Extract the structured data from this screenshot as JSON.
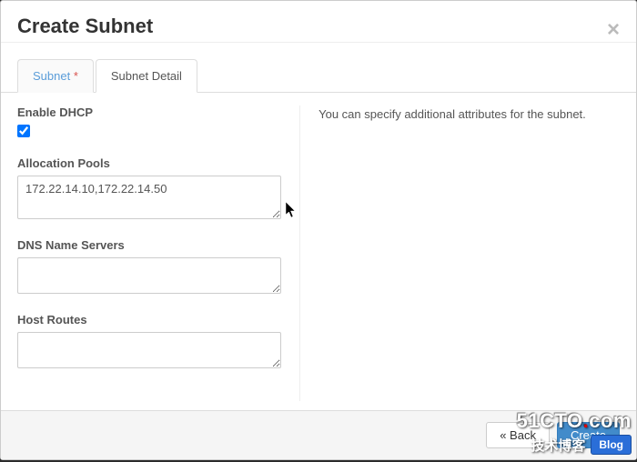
{
  "modal": {
    "title": "Create Subnet",
    "close_glyph": "×"
  },
  "tabs": {
    "subnet": {
      "label": "Subnet",
      "asterisk": "*"
    },
    "detail": {
      "label": "Subnet Detail"
    }
  },
  "form": {
    "enable_dhcp_label": "Enable DHCP",
    "enable_dhcp_checked": true,
    "allocation_pools_label": "Allocation Pools",
    "allocation_pools_value": "172.22.14.10,172.22.14.50",
    "dns_label": "DNS Name Servers",
    "dns_value": "",
    "host_routes_label": "Host Routes",
    "host_routes_value": ""
  },
  "help": {
    "text": "You can specify additional attributes for the subnet."
  },
  "footer": {
    "back_label": "« Back",
    "create_label": "Create"
  },
  "watermark": {
    "site": "51CTO",
    "dot": ".",
    "tld": "com",
    "cn": "技术博客",
    "badge": "Blog"
  }
}
